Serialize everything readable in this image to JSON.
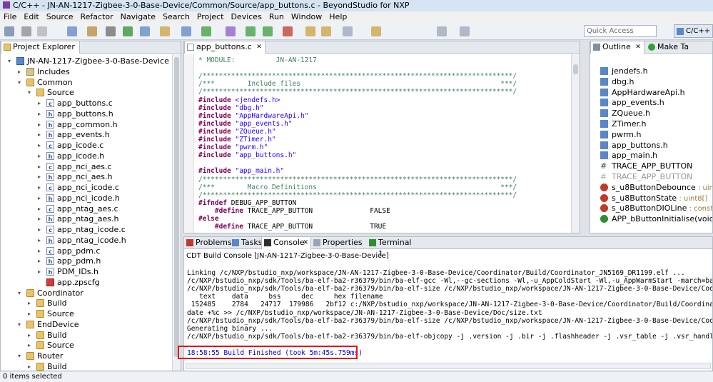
{
  "window": {
    "title": "C/C++ - JN-AN-1217-Zigbee-3-0-Base-Device/Common/Source/app_buttons.c - BeyondStudio for NXP"
  },
  "menu": [
    "File",
    "Edit",
    "Source",
    "Refactor",
    "Navigate",
    "Search",
    "Project",
    "Devices",
    "Run",
    "Window",
    "Help"
  ],
  "toolbar": {
    "quick_access_placeholder": "Quick Access",
    "perspective_label": "C/C++"
  },
  "project_explorer": {
    "tab_label": "Project Explorer",
    "tree": [
      {
        "label": "JN-AN-1217-Zigbee-3-0-Base-Device",
        "indent": 0,
        "icon": "project-icon",
        "arrow": "▾"
      },
      {
        "label": "Includes",
        "indent": 1,
        "icon": "includes-icon",
        "arrow": "▸"
      },
      {
        "label": "Common",
        "indent": 1,
        "icon": "folder-icon",
        "arrow": "▾"
      },
      {
        "label": "Source",
        "indent": 2,
        "icon": "source-folder-icon",
        "arrow": "▾"
      },
      {
        "label": "app_buttons.c",
        "indent": 3,
        "icon": "c-file-icon",
        "arrow": "▸"
      },
      {
        "label": "app_buttons.h",
        "indent": 3,
        "icon": "h-file-icon",
        "arrow": "▸"
      },
      {
        "label": "app_common.h",
        "indent": 3,
        "icon": "h-file-icon",
        "arrow": "▸"
      },
      {
        "label": "app_events.h",
        "indent": 3,
        "icon": "h-file-icon",
        "arrow": "▸"
      },
      {
        "label": "app_icode.c",
        "indent": 3,
        "icon": "c-file-icon",
        "arrow": "▸"
      },
      {
        "label": "app_icode.h",
        "indent": 3,
        "icon": "h-file-icon",
        "arrow": "▸"
      },
      {
        "label": "app_nci_aes.c",
        "indent": 3,
        "icon": "c-file-icon",
        "arrow": "▸"
      },
      {
        "label": "app_nci_aes.h",
        "indent": 3,
        "icon": "h-file-icon",
        "arrow": "▸"
      },
      {
        "label": "app_nci_icode.c",
        "indent": 3,
        "icon": "c-file-icon",
        "arrow": "▸"
      },
      {
        "label": "app_nci_icode.h",
        "indent": 3,
        "icon": "h-file-icon",
        "arrow": "▸"
      },
      {
        "label": "app_ntag_aes.c",
        "indent": 3,
        "icon": "c-file-icon",
        "arrow": "▸"
      },
      {
        "label": "app_ntag_aes.h",
        "indent": 3,
        "icon": "h-file-icon",
        "arrow": "▸"
      },
      {
        "label": "app_ntag_icode.c",
        "indent": 3,
        "icon": "c-file-icon",
        "arrow": "▸"
      },
      {
        "label": "app_ntag_icode.h",
        "indent": 3,
        "icon": "h-file-icon",
        "arrow": "▸"
      },
      {
        "label": "app_pdm.c",
        "indent": 3,
        "icon": "c-file-icon",
        "arrow": "▸"
      },
      {
        "label": "app_pdm.h",
        "indent": 3,
        "icon": "h-file-icon",
        "arrow": "▸"
      },
      {
        "label": "PDM_IDs.h",
        "indent": 3,
        "icon": "h-file-icon",
        "arrow": "▸"
      },
      {
        "label": "app.zpscfg",
        "indent": 3,
        "icon": "zpscfg-file-icon",
        "arrow": ""
      },
      {
        "label": "Coordinator",
        "indent": 1,
        "icon": "folder-icon",
        "arrow": "▾"
      },
      {
        "label": "Build",
        "indent": 2,
        "icon": "folder-icon",
        "arrow": "▸"
      },
      {
        "label": "Source",
        "indent": 2,
        "icon": "folder-icon",
        "arrow": "▸"
      },
      {
        "label": "EndDevice",
        "indent": 1,
        "icon": "folder-icon",
        "arrow": "▾"
      },
      {
        "label": "Build",
        "indent": 2,
        "icon": "folder-icon",
        "arrow": "▸"
      },
      {
        "label": "Source",
        "indent": 2,
        "icon": "folder-icon",
        "arrow": "▸"
      },
      {
        "label": "Router",
        "indent": 1,
        "icon": "folder-icon",
        "arrow": "▾"
      },
      {
        "label": "Build",
        "indent": 2,
        "icon": "folder-icon",
        "arrow": "▸"
      }
    ]
  },
  "editor": {
    "tab_label": "app_buttons.c",
    "lines": [
      [
        {
          "t": "* MODULE:          JN-AN-1217",
          "c": "c"
        }
      ],
      [
        {
          "t": "",
          "c": "n"
        }
      ],
      [
        {
          "t": "/****************************************************************************/",
          "c": "c"
        }
      ],
      [
        {
          "t": "/***        Include files                                                 ***/",
          "c": "c"
        }
      ],
      [
        {
          "t": "/****************************************************************************/",
          "c": "c"
        }
      ],
      [
        {
          "t": "#include ",
          "c": "pp"
        },
        {
          "t": "<jendefs.h>",
          "c": "s"
        }
      ],
      [
        {
          "t": "#include ",
          "c": "pp"
        },
        {
          "t": "\"dbg.h\"",
          "c": "s"
        }
      ],
      [
        {
          "t": "#include ",
          "c": "pp"
        },
        {
          "t": "\"AppHardwareApi.h\"",
          "c": "s"
        }
      ],
      [
        {
          "t": "#include ",
          "c": "pp"
        },
        {
          "t": "\"app_events.h\"",
          "c": "s"
        }
      ],
      [
        {
          "t": "#include ",
          "c": "pp"
        },
        {
          "t": "\"ZQueue.h\"",
          "c": "s"
        }
      ],
      [
        {
          "t": "#include ",
          "c": "pp"
        },
        {
          "t": "\"ZTimer.h\"",
          "c": "s"
        }
      ],
      [
        {
          "t": "#include ",
          "c": "pp"
        },
        {
          "t": "\"pwrm.h\"",
          "c": "s"
        }
      ],
      [
        {
          "t": "#include ",
          "c": "pp"
        },
        {
          "t": "\"app_buttons.h\"",
          "c": "s"
        }
      ],
      [
        {
          "t": "",
          "c": "n"
        }
      ],
      [
        {
          "t": "#include ",
          "c": "pp"
        },
        {
          "t": "\"app_main.h\"",
          "c": "s"
        }
      ],
      [
        {
          "t": "/****************************************************************************/",
          "c": "c"
        }
      ],
      [
        {
          "t": "/***        Macro Definitions                                             ***/",
          "c": "c"
        }
      ],
      [
        {
          "t": "/****************************************************************************/",
          "c": "c"
        }
      ],
      [
        {
          "t": "#ifndef ",
          "c": "pp"
        },
        {
          "t": "DEBUG_APP_BUTTON",
          "c": "n"
        }
      ],
      [
        {
          "t": "    #define ",
          "c": "pp"
        },
        {
          "t": "TRACE_APP_BUTTON              FALSE",
          "c": "n"
        }
      ],
      [
        {
          "t": "#else",
          "c": "pp"
        }
      ],
      [
        {
          "t": "    #define ",
          "c": "pp"
        },
        {
          "t": "TRACE_APP_BUTTON              TRUE",
          "c": "n"
        }
      ]
    ]
  },
  "outline": {
    "tab_label": "Outline",
    "tab2_label": "Make Ta",
    "items": [
      {
        "label": "jendefs.h",
        "icon": "include-icon",
        "type": ""
      },
      {
        "label": "dbg.h",
        "icon": "include-icon",
        "type": ""
      },
      {
        "label": "AppHardwareApi.h",
        "icon": "include-icon",
        "type": ""
      },
      {
        "label": "app_events.h",
        "icon": "include-icon",
        "type": ""
      },
      {
        "label": "ZQueue.h",
        "icon": "include-icon",
        "type": ""
      },
      {
        "label": "ZTimer.h",
        "icon": "include-icon",
        "type": ""
      },
      {
        "label": "pwrm.h",
        "icon": "include-icon",
        "type": ""
      },
      {
        "label": "app_buttons.h",
        "icon": "include-icon",
        "type": ""
      },
      {
        "label": "app_main.h",
        "icon": "include-icon",
        "type": ""
      },
      {
        "label": "TRACE_APP_BUTTON",
        "icon": "macro-icon",
        "type": ""
      },
      {
        "label": "TRACE_APP_BUTTON",
        "icon": "macro-icon-disabled",
        "type": ""
      },
      {
        "label": "s_u8ButtonDebounce",
        "icon": "variable-icon",
        "type": " : uint8["
      },
      {
        "label": "s_u8ButtonState",
        "icon": "variable-icon",
        "type": " : uint8[]"
      },
      {
        "label": "s_u8ButtonDIOLine",
        "icon": "variable-icon",
        "type": " : const uint"
      },
      {
        "label": "APP_bButtonInitialise(void)",
        "icon": "function-icon",
        "type": " : bo"
      }
    ]
  },
  "bottom_tabs": [
    {
      "label": "Problems",
      "icon": "problems-icon"
    },
    {
      "label": "Tasks",
      "icon": "tasks-icon"
    },
    {
      "label": "Console",
      "icon": "console-icon"
    },
    {
      "label": "Properties",
      "icon": "properties-icon"
    },
    {
      "label": "Terminal 1",
      "icon": "terminal-icon"
    }
  ],
  "console": {
    "title": "CDT Build Console [JN-AN-1217-Zigbee-3-0-Base-Device]",
    "lines": [
      "Linking /c/NXP/bstudio_nxp/workspace/JN-AN-1217-Zigbee-3-0-Base-Device/Coordinator/Build/Coordinator_JN5169_DR1199.elf ...",
      "/c/NXP/bstudio_nxp/sdk/Tools/ba-elf-ba2-r36379/bin/ba-elf-gcc -Wl,--gc-sections -Wl,-u_AppColdStart -Wl,-u_AppWarmStart -march=ba2 -mcpu=jn51xx",
      "/c/NXP/bstudio_nxp/sdk/Tools/ba-elf-ba2-r36379/bin/ba-elf-size /c/NXP/bstudio_nxp/workspace/JN-AN-1217-Zigbee-3-0-Base-Device/Coordinator/Build",
      "   text    data     bss     dec     hex filename",
      " 152485    2784   24717  179986   2bf12 c:/NXP/bstudio_nxp/workspace/JN-AN-1217-Zigbee-3-0-Base-Device/Coordinator/Build/Coordinator_JN5169_DR",
      "date +%c >> /c/NXP/bstudio_nxp/workspace/JN-AN-1217-Zigbee-3-0-Base-Device/Doc/size.txt",
      "/c/NXP/bstudio_nxp/sdk/Tools/ba-elf-ba2-r36379/bin/ba-elf-size /c/NXP/bstudio_nxp/workspace/JN-AN-1217-Zigbee-3-0-Base-Device/Coordinator/Build",
      "Generating binary ...",
      "/c/NXP/bstudio_nxp/sdk/Tools/ba-elf-ba2-r36379/bin/ba-elf-objcopy -j .version -j .bir -j .flashheader -j .vsr_table -j .vsr_handlers -j .rodat"
    ],
    "finished": "18:58:55 Build Finished (took 5m:45s.759ms)"
  },
  "status": {
    "text": "0 items selected"
  },
  "colors": {
    "accent": "#e01818",
    "panel_border": "#b6bcc6",
    "keyword": "#7f0055",
    "string": "#2a00ff",
    "comment": "#3f7f5f"
  }
}
